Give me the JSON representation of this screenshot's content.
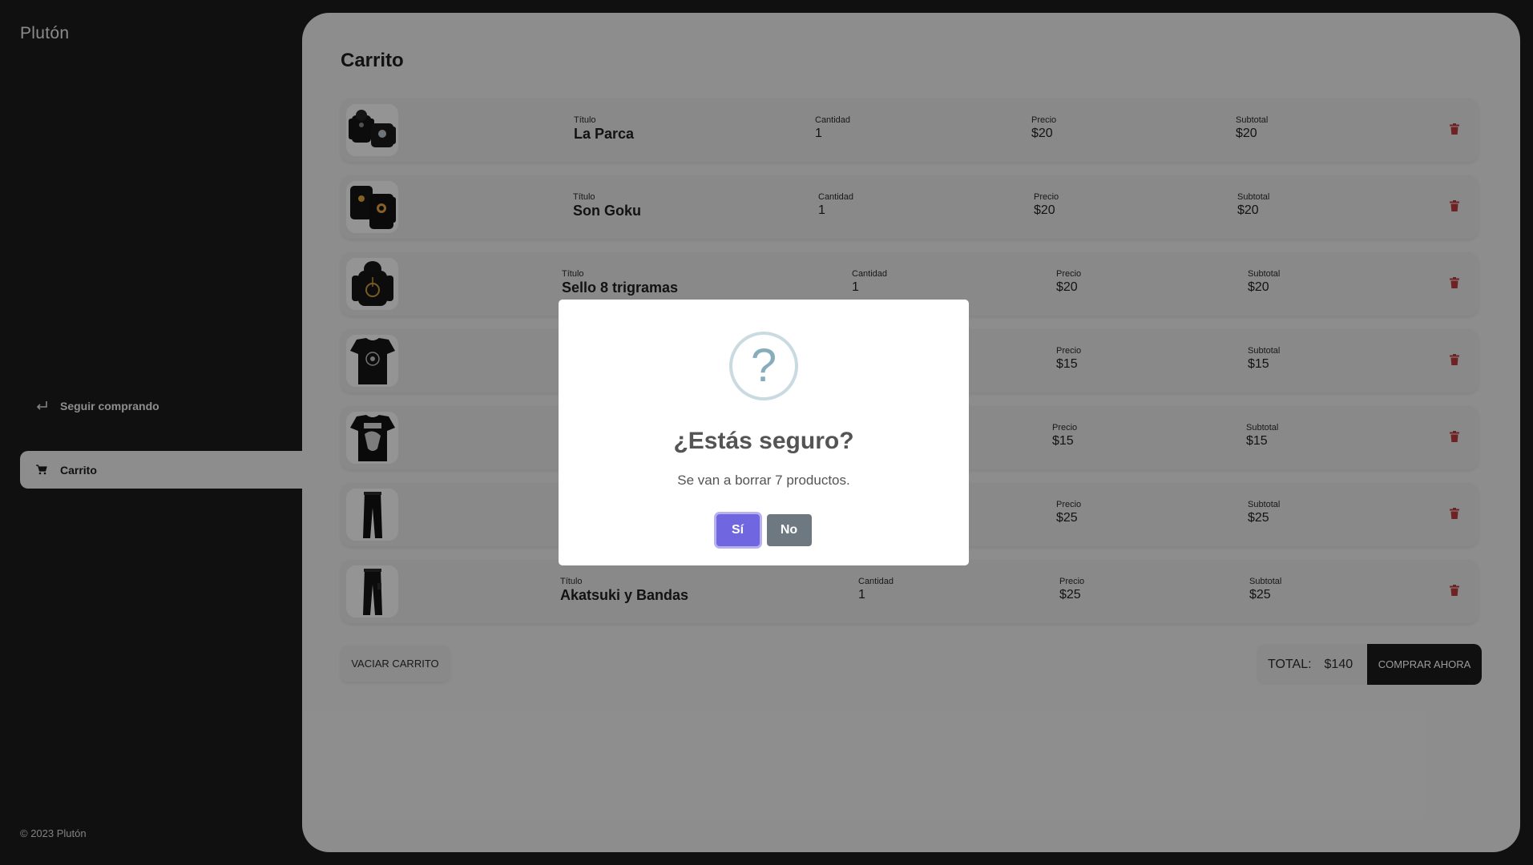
{
  "sidebar": {
    "logo": "Plutón",
    "items": [
      {
        "label": "Seguir comprando",
        "icon": "return-arrow-icon"
      },
      {
        "label": "Carrito",
        "icon": "cart-icon"
      }
    ],
    "copyright": "© 2023 Plutón"
  },
  "cart": {
    "title": "Carrito",
    "labels": {
      "title": "Título",
      "quantity": "Cantidad",
      "price": "Precio",
      "subtotal": "Subtotal"
    },
    "items": [
      {
        "title": "La Parca",
        "quantity": "1",
        "price": "$20",
        "subtotal": "$20",
        "image": "black-hoodie-set"
      },
      {
        "title": "Son Goku",
        "quantity": "1",
        "price": "$20",
        "subtotal": "$20",
        "image": "black-hoodie-orange-symbol"
      },
      {
        "title": "Sello 8 trigramas",
        "quantity": "1",
        "price": "$20",
        "subtotal": "$20",
        "image": "black-hoodie-gold-seal"
      },
      {
        "title": "",
        "quantity": "",
        "price": "$15",
        "subtotal": "$15",
        "image": "black-tshirt"
      },
      {
        "title": "",
        "quantity": "",
        "price": "$15",
        "subtotal": "$15",
        "image": "black-tshirt-print"
      },
      {
        "title": "",
        "quantity": "",
        "price": "$25",
        "subtotal": "$25",
        "image": "black-pants"
      },
      {
        "title": "Akatsuki y Bandas",
        "quantity": "1",
        "price": "$25",
        "subtotal": "$25",
        "image": "black-pants"
      }
    ],
    "empty_button": "VACIAR CARRITO",
    "total_label": "TOTAL:",
    "total_value": "$140",
    "buy_button": "COMPRAR AHORA"
  },
  "dialog": {
    "icon": "question-icon",
    "icon_glyph": "?",
    "title": "¿Estás seguro?",
    "text": "Se van a borrar 7 productos.",
    "confirm": "Sí",
    "cancel": "No"
  },
  "colors": {
    "accent": "#7066e0",
    "delete": "#b73b3b",
    "dark": "#1b1b1b"
  }
}
